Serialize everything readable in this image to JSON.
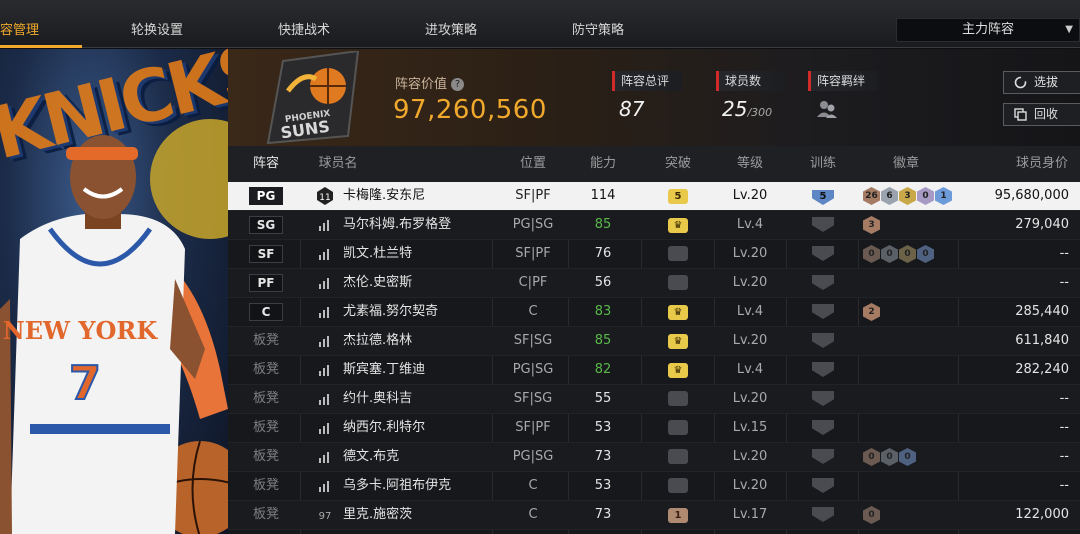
{
  "tabs": [
    {
      "label": "容管理",
      "active": true
    },
    {
      "label": "轮换设置",
      "active": false
    },
    {
      "label": "快捷战术",
      "active": false
    },
    {
      "label": "进攻策略",
      "active": false
    },
    {
      "label": "防守策略",
      "active": false
    }
  ],
  "lineup_select": "主力阵容",
  "left_art": {
    "team_text": "KNICKS",
    "jersey_team": "NEW YORK",
    "jersey_number": "7"
  },
  "banner": {
    "team_logo": {
      "line1": "PHOENIX",
      "line2": "SUNS"
    },
    "value_label": "阵容价值",
    "value": "97,260,560",
    "rating_label": "阵容总评",
    "rating": "87",
    "count_label": "球员数",
    "count": "25",
    "count_max": "/300",
    "bond_label": "阵容羁绊",
    "select_btn": "选拔",
    "recycle_btn": "回收"
  },
  "columns": [
    "阵容",
    "球员名",
    "位置",
    "能力",
    "突破",
    "等级",
    "训练",
    "徽章",
    "球员身价"
  ],
  "rows": [
    {
      "slot": "PG",
      "starter": true,
      "idx": "11",
      "name": "卡梅隆.安东尼",
      "pos": "SF|PF",
      "ability": "114",
      "ability_green": false,
      "break": "5",
      "break_type": "gold",
      "level": "Lv.20",
      "train": "5",
      "train_type": "blue",
      "badges": [
        "26",
        "6",
        "3",
        "0",
        "1"
      ],
      "badge_colors": [
        "#a57b64",
        "#9aa3ae",
        "#c9a84a",
        "#a79ac4",
        "#6d9ad8"
      ],
      "value": "95,680,000",
      "selected": true
    },
    {
      "slot": "SG",
      "starter": true,
      "idx": "",
      "name": "马尔科姆.布罗格登",
      "pos": "PG|SG",
      "ability": "85",
      "ability_green": true,
      "break": "♛",
      "break_type": "gold",
      "level": "Lv.4",
      "train": "",
      "train_type": "",
      "badges": [
        "3"
      ],
      "badge_colors": [
        "#a57b64"
      ],
      "value": "279,040",
      "selected": false
    },
    {
      "slot": "SF",
      "starter": true,
      "idx": "",
      "name": "凯文.杜兰特",
      "pos": "SF|PF",
      "ability": "76",
      "ability_green": false,
      "break": "",
      "break_type": "",
      "level": "Lv.20",
      "train": "",
      "train_type": "",
      "badges": [
        "0",
        "0",
        "0",
        "0"
      ],
      "badge_colors": [
        "#6b5a52",
        "#5b5f66",
        "#6b6248",
        "#4f6180"
      ],
      "value": "--",
      "selected": false
    },
    {
      "slot": "PF",
      "starter": true,
      "idx": "",
      "name": "杰伦.史密斯",
      "pos": "C|PF",
      "ability": "56",
      "ability_green": false,
      "break": "",
      "break_type": "",
      "level": "Lv.20",
      "train": "",
      "train_type": "",
      "badges": [],
      "badge_colors": [],
      "value": "--",
      "selected": false
    },
    {
      "slot": "C",
      "starter": true,
      "idx": "",
      "name": "尤素福.努尔契奇",
      "pos": "C",
      "ability": "83",
      "ability_green": true,
      "break": "♛",
      "break_type": "gold",
      "level": "Lv.4",
      "train": "",
      "train_type": "",
      "badges": [
        "2"
      ],
      "badge_colors": [
        "#a57b64"
      ],
      "value": "285,440",
      "selected": false
    },
    {
      "slot": "板凳",
      "starter": false,
      "idx": "",
      "name": "杰拉德.格林",
      "pos": "SF|SG",
      "ability": "85",
      "ability_green": true,
      "break": "♛",
      "break_type": "gold",
      "level": "Lv.20",
      "train": "",
      "train_type": "",
      "badges": [],
      "badge_colors": [],
      "value": "611,840",
      "selected": false
    },
    {
      "slot": "板凳",
      "starter": false,
      "idx": "",
      "name": "斯宾塞.丁维迪",
      "pos": "PG|SG",
      "ability": "82",
      "ability_green": true,
      "break": "♛",
      "break_type": "gold",
      "level": "Lv.4",
      "train": "",
      "train_type": "",
      "badges": [],
      "badge_colors": [],
      "value": "282,240",
      "selected": false
    },
    {
      "slot": "板凳",
      "starter": false,
      "idx": "",
      "name": "约什.奥科吉",
      "pos": "SF|SG",
      "ability": "55",
      "ability_green": false,
      "break": "",
      "break_type": "",
      "level": "Lv.20",
      "train": "",
      "train_type": "",
      "badges": [],
      "badge_colors": [],
      "value": "--",
      "selected": false
    },
    {
      "slot": "板凳",
      "starter": false,
      "idx": "",
      "name": "纳西尔.利特尔",
      "pos": "SF|PF",
      "ability": "53",
      "ability_green": false,
      "break": "",
      "break_type": "",
      "level": "Lv.15",
      "train": "",
      "train_type": "",
      "badges": [],
      "badge_colors": [],
      "value": "--",
      "selected": false
    },
    {
      "slot": "板凳",
      "starter": false,
      "idx": "",
      "name": "德文.布克",
      "pos": "PG|SG",
      "ability": "73",
      "ability_green": false,
      "break": "",
      "break_type": "",
      "level": "Lv.20",
      "train": "",
      "train_type": "",
      "badges": [
        "0",
        "0",
        "0"
      ],
      "badge_colors": [
        "#6b5a52",
        "#5b5f66",
        "#4f6180"
      ],
      "value": "--",
      "selected": false
    },
    {
      "slot": "板凳",
      "starter": false,
      "idx": "",
      "name": "乌多卡.阿祖布伊克",
      "pos": "C",
      "ability": "53",
      "ability_green": false,
      "break": "",
      "break_type": "",
      "level": "Lv.20",
      "train": "",
      "train_type": "",
      "badges": [],
      "badge_colors": [],
      "value": "--",
      "selected": false
    },
    {
      "slot": "板凳",
      "starter": false,
      "idx": "97",
      "name": "里克.施密茨",
      "pos": "C",
      "ability": "73",
      "ability_green": false,
      "break": "1",
      "break_type": "bronze",
      "level": "Lv.17",
      "train": "",
      "train_type": "",
      "badges": [
        "0"
      ],
      "badge_colors": [
        "#6b5a52"
      ],
      "value": "122,000",
      "selected": false
    }
  ]
}
